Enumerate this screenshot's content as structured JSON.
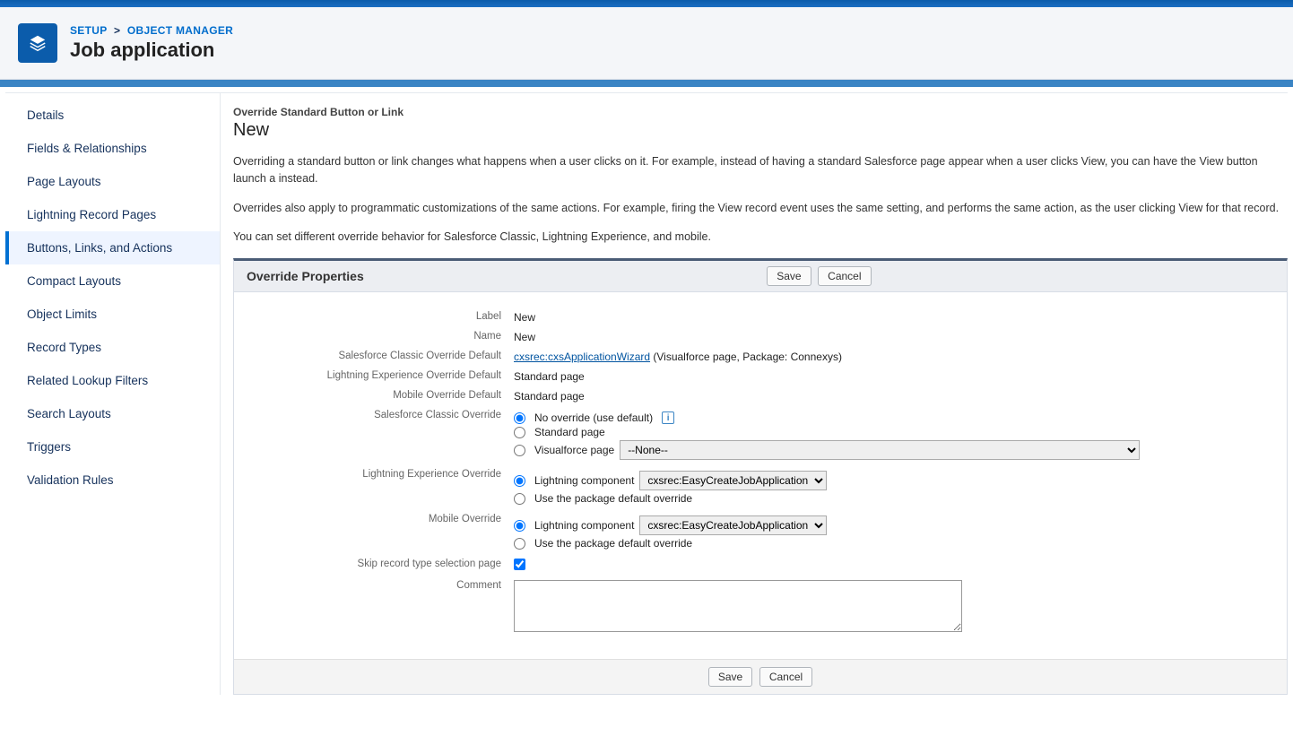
{
  "breadcrumb": {
    "setup": "SETUP",
    "sep": ">",
    "object_manager": "OBJECT MANAGER"
  },
  "page_title": "Job application",
  "sidebar": {
    "items": [
      "Details",
      "Fields & Relationships",
      "Page Layouts",
      "Lightning Record Pages",
      "Buttons, Links, and Actions",
      "Compact Layouts",
      "Object Limits",
      "Record Types",
      "Related Lookup Filters",
      "Search Layouts",
      "Triggers",
      "Validation Rules"
    ],
    "active_index": 4
  },
  "sub_heading": "Override Standard Button or Link",
  "heading": "New",
  "intro": {
    "p1": "Overriding a standard button or link changes what happens when a user clicks on it. For example, instead of having a standard Salesforce page appear when a user clicks View, you can have the View button launch a instead.",
    "p2": "Overrides also apply to programmatic customizations of the same actions. For example, firing the View record event uses the same setting, and performs the same action, as the user clicking View for that record.",
    "p3": "You can set different override behavior for Salesforce Classic, Lightning Experience, and mobile."
  },
  "panel": {
    "title": "Override Properties",
    "save": "Save",
    "cancel": "Cancel"
  },
  "form": {
    "labels": {
      "label": "Label",
      "name": "Name",
      "classic_default": "Salesforce Classic Override Default",
      "lex_default": "Lightning Experience Override Default",
      "mobile_default": "Mobile Override Default",
      "classic_override": "Salesforce Classic Override",
      "lex_override": "Lightning Experience Override",
      "mobile_override": "Mobile Override",
      "skip": "Skip record type selection page",
      "comment": "Comment"
    },
    "values": {
      "label": "New",
      "name": "New",
      "classic_default_link": "cxsrec:cxsApplicationWizard",
      "classic_default_suffix": " (Visualforce page, Package: Connexys)",
      "lex_default": "Standard page",
      "mobile_default": "Standard page"
    },
    "options": {
      "no_override": "No override (use default)",
      "standard_page": "Standard page",
      "visualforce_page": "Visualforce page",
      "lightning_component": "Lightning component",
      "use_package_default": "Use the package default override",
      "vf_none": "--None--",
      "lc_value": "cxsrec:EasyCreateJobApplication"
    }
  }
}
